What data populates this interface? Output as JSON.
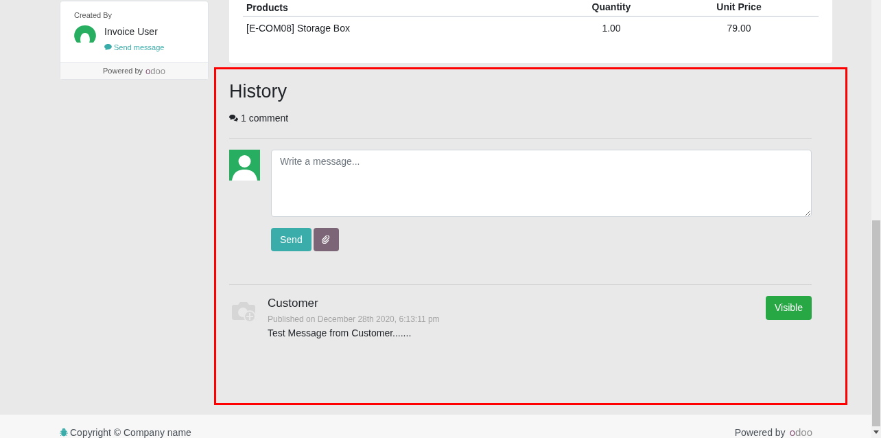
{
  "sidebar": {
    "created_by_label": "Created By",
    "user_name": "Invoice User",
    "send_message": "Send message",
    "powered_by": "Powered by",
    "logo": "odoo"
  },
  "order_table": {
    "columns": [
      "Products",
      "Quantity",
      "Unit Price"
    ],
    "rows": [
      {
        "product": "[E-COM08] Storage Box",
        "quantity": "1.00",
        "unit_price": "79.00"
      }
    ]
  },
  "history": {
    "title": "History",
    "comment_count": "1 comment",
    "composer": {
      "placeholder": "Write a message...",
      "send_button": "Send"
    },
    "messages": [
      {
        "author": "Customer",
        "published": "Published on December 28th 2020, 6:13:11 pm",
        "body": "Test Message from Customer.......",
        "badge": "Visible"
      }
    ]
  },
  "footer": {
    "copyright": "Copyright © Company name",
    "powered_by": "Powered by",
    "logo": "odoo"
  }
}
